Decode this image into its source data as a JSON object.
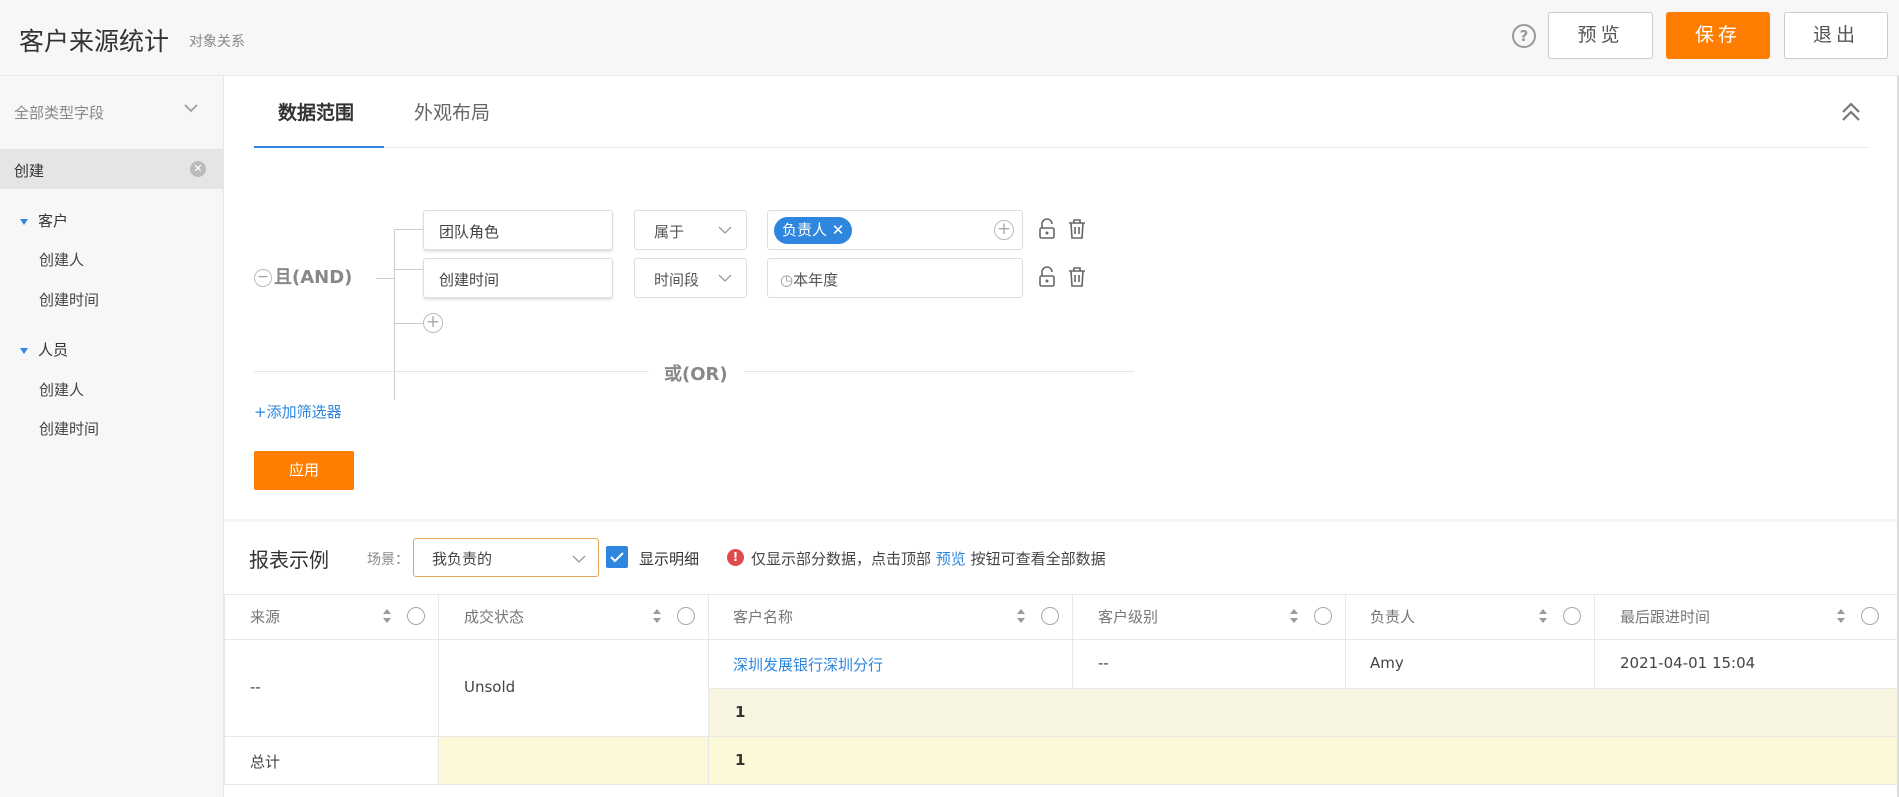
{
  "header": {
    "title": "客户来源统计",
    "subtitle": "对象关系",
    "help_icon": "?",
    "preview_label": "预览",
    "save_label": "保存",
    "exit_label": "退出"
  },
  "sidebar": {
    "field_type": "全部类型字段",
    "search_value": "创建",
    "groups": [
      {
        "name": "客户",
        "items": [
          "创建人",
          "创建时间"
        ]
      },
      {
        "name": "人员",
        "items": [
          "创建人",
          "创建时间"
        ]
      }
    ]
  },
  "tabs": [
    {
      "label": "数据范围",
      "active": true
    },
    {
      "label": "外观布局",
      "active": false
    }
  ],
  "filter": {
    "and_label": "且(AND)",
    "conditions": [
      {
        "field": "团队角色",
        "operator": "属于",
        "value_tag": "负责人"
      },
      {
        "field": "创建时间",
        "operator": "时间段",
        "value": "本年度"
      }
    ],
    "or_label": "或(OR)",
    "add_filter": "+添加筛选器",
    "apply_label": "应用"
  },
  "report": {
    "title": "报表示例",
    "scene_label": "场景：",
    "scene_value": "我负责的",
    "show_detail_label": "显示明细",
    "show_detail_checked": true,
    "notice_prefix": "仅显示部分数据，点击顶部",
    "notice_link": "预览",
    "notice_suffix": "按钮可查看全部数据",
    "columns": [
      "来源",
      "成交状态",
      "客户名称",
      "客户级别",
      "负责人",
      "最后跟进时间"
    ],
    "rows": [
      {
        "source": "--",
        "status": "Unsold",
        "customer": "深圳发展银行深圳分行",
        "level": "--",
        "owner": "Amy",
        "last_follow": "2021-04-01 15:04"
      }
    ],
    "subtotal": "1",
    "total_label": "总计",
    "total_value": "1"
  },
  "colors": {
    "accent": "#ff7d00",
    "link": "#2e86de",
    "subtotal_bg": "#f7f4e2",
    "total_bg": "#fcf9d8"
  }
}
